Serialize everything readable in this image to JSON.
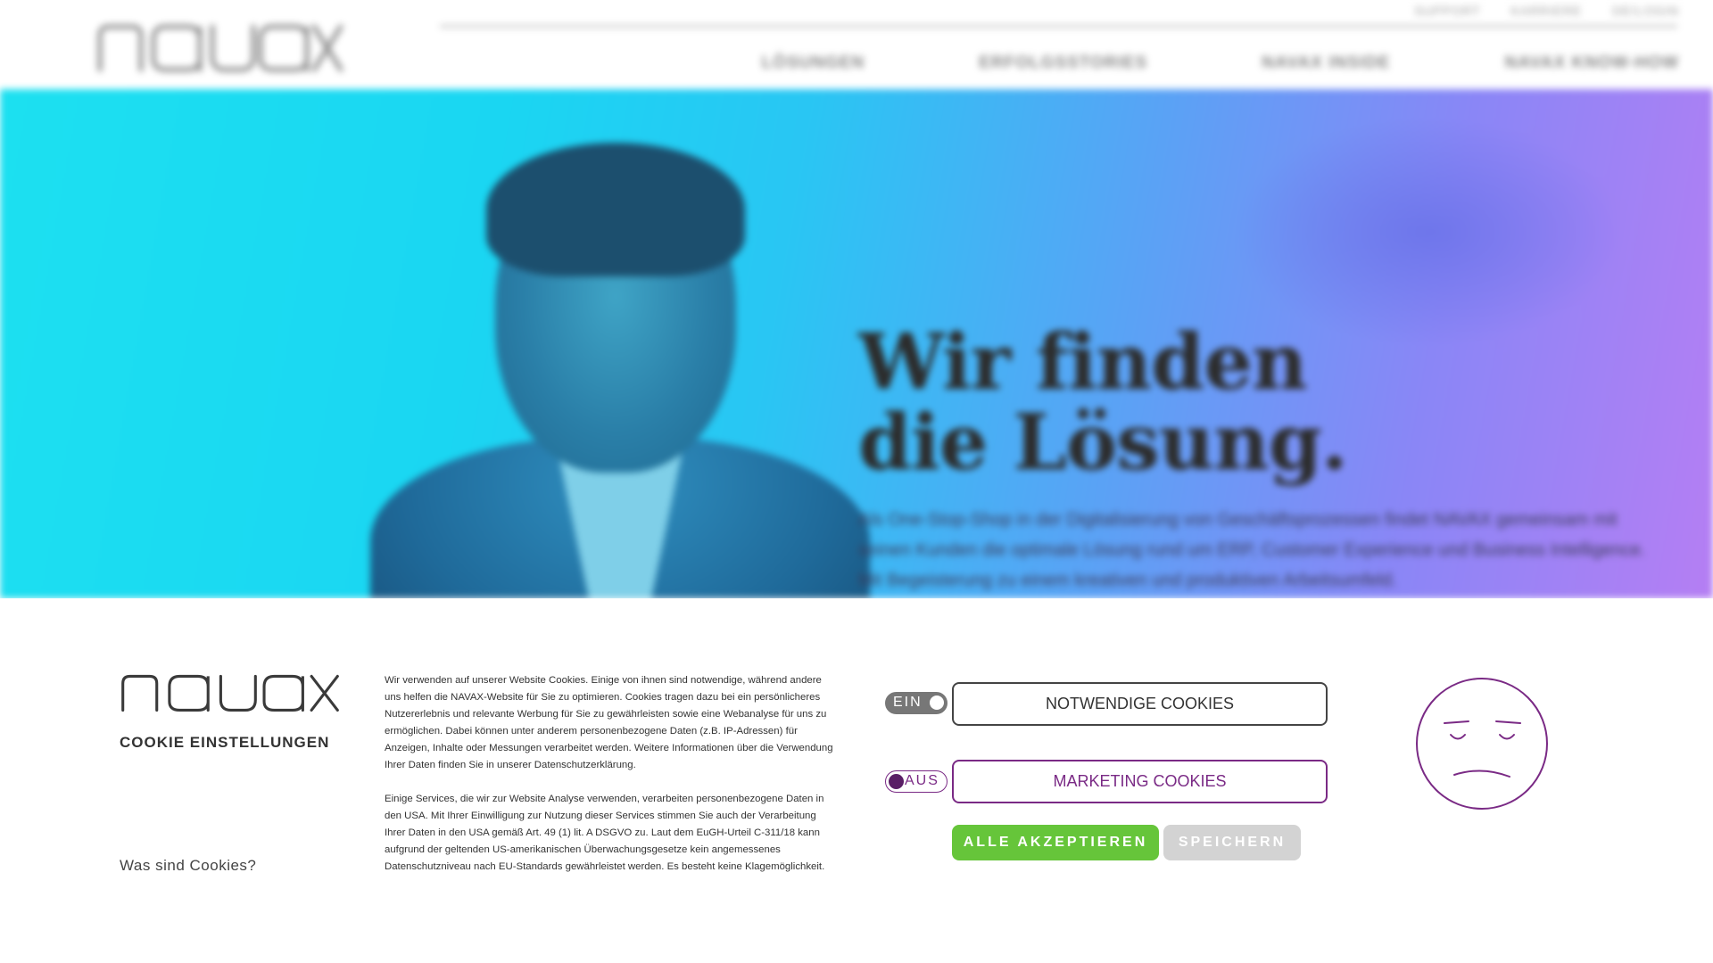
{
  "header": {
    "logo_text": "navax",
    "utility_nav": [
      "SUPPORT",
      "KARRIERE",
      "DE/LOGIN"
    ],
    "main_nav": [
      "LÖSUNGEN",
      "ERFOLGSSTORIES",
      "NAVAX INSIDE",
      "NAVAX KNOW-HOW"
    ]
  },
  "hero": {
    "title_line1": "Wir finden",
    "title_line2": "die Lösung.",
    "subtitle": "Als One-Stop-Shop in der Digitalisierung von Geschäftsprozessen findet NAVAX gemeinsam mit seinen Kunden die optimale Lösung rund um ERP, Customer Experience und Business Intelligence. Mit Begeisterung zu einem kreativen und produktiven Arbeitsumfeld."
  },
  "cookie": {
    "logo_text": "navax",
    "heading": "COOKIE EINSTELLUNGEN",
    "what_link": "Was sind Cookies?",
    "paragraph1": "Wir verwenden auf unserer Website Cookies. Einige von ihnen sind notwendige, während andere uns helfen die NAVAX-Website für Sie zu optimieren. Cookies tragen dazu bei ein persönlicheres Nutzererlebnis und relevante Werbung für Sie zu gewährleisten sowie eine Webanalyse für uns zu ermöglichen. Dabei können unter anderem personenbezogene Daten (z.B. IP-Adressen) für Anzeigen, Inhalte oder Messungen verarbeitet werden. Weitere Informationen über die Verwendung Ihrer Daten finden Sie in unserer Datenschutzerklärung.",
    "paragraph2": "Einige Services, die wir zur Website Analyse verwenden, verarbeiten personenbezogene Daten in den USA. Mit Ihrer Einwilligung zur Nutzung dieser Services stimmen Sie auch der Verarbeitung Ihrer Daten in den USA gemäß Art. 49 (1) lit. A DSGVO zu. Laut dem EuGH-Urteil C-311/18 kann aufgrund der geltenden US-amerikanischen Überwachungsgesetze kein angemessenes Datenschutzniveau nach EU-Standards gewährleistet werden. Es besteht keine Klagemöglichkeit.",
    "toggle_on_label": "EIN",
    "toggle_off_label": "AUS",
    "necessary_label": "NOTWENDIGE COOKIES",
    "marketing_label": "MARKETING COOKIES",
    "accept_all_label": "ALLE AKZEPTIEREN",
    "save_label": "SPEICHERN",
    "face_icon": "sad-face-icon"
  },
  "colors": {
    "accent_purple": "#7a2a85",
    "accept_green": "#66c53a",
    "save_grey": "#d3d3d3"
  }
}
